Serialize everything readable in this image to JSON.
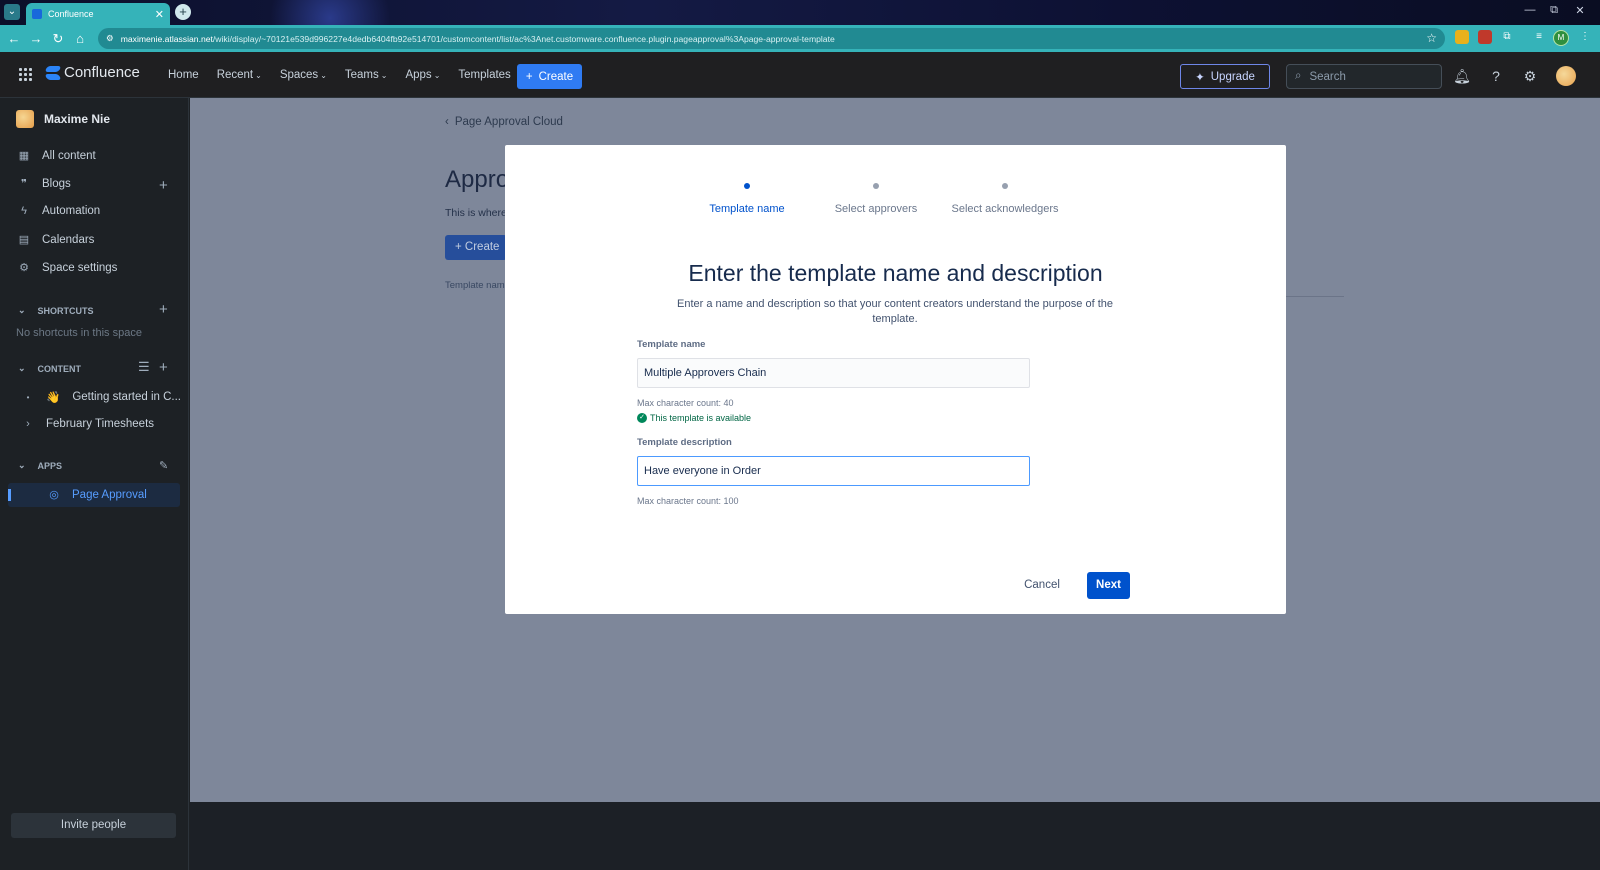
{
  "browser": {
    "tab_title": "Confluence",
    "url_host": "maximenie.atlassian.net",
    "url_path": "/wiki/display/~70121e539d996227e4dedb6404fb92e514701/customcontent/list/ac%3Anet.customware.confluence.plugin.pageapproval%3Apage-approval-template",
    "profile_initial": "M"
  },
  "topnav": {
    "logo_text": "Confluence",
    "items": [
      "Home",
      "Recent",
      "Spaces",
      "Teams",
      "Apps",
      "Templates"
    ],
    "create_label": "Create",
    "upgrade_label": "Upgrade",
    "search_placeholder": "Search"
  },
  "sidebar": {
    "space_name": "Maxime Nie",
    "items": [
      {
        "label": "All content",
        "icon": "grid-icon"
      },
      {
        "label": "Blogs",
        "icon": "quote-icon"
      },
      {
        "label": "Automation",
        "icon": "bolt-icon"
      },
      {
        "label": "Calendars",
        "icon": "calendar-icon"
      },
      {
        "label": "Space settings",
        "icon": "gear-icon"
      }
    ],
    "shortcuts_heading": "SHORTCUTS",
    "no_shortcuts": "No shortcuts in this space",
    "content_heading": "CONTENT",
    "content_items": [
      {
        "label": "Getting started in C...",
        "emoji": "👋"
      },
      {
        "label": "February Timesheets"
      }
    ],
    "apps_heading": "APPS",
    "apps_items": [
      {
        "label": "Page Approval"
      }
    ],
    "invite_label": "Invite people"
  },
  "background_page": {
    "back_link": "Page Approval Cloud",
    "title": "Appro",
    "subtitle": "This is where",
    "create_label": "Create",
    "column_header": "Template nam"
  },
  "modal": {
    "steps": [
      {
        "label": "Template name",
        "active": true
      },
      {
        "label": "Select approvers",
        "active": false
      },
      {
        "label": "Select acknowledgers",
        "active": false
      }
    ],
    "title": "Enter the template name and description",
    "description": "Enter a name and description so that your content creators understand the purpose of the template.",
    "name_label": "Template name",
    "name_value": "Multiple Approvers Chain",
    "name_help": "Max character count: 40",
    "name_valid": "This template is available",
    "desc_label": "Template description",
    "desc_value": "Have everyone in Order",
    "desc_help": "Max character count: 100",
    "cancel_label": "Cancel",
    "next_label": "Next"
  },
  "colors": {
    "browser_accent": "#35b3b9",
    "primary_blue": "#0052cc",
    "create_blue": "#2f7bf3",
    "valid_green": "#00875a"
  }
}
